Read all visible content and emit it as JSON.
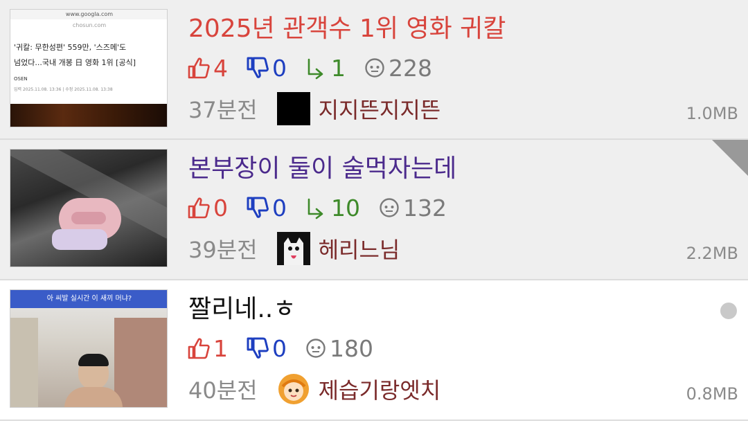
{
  "colors": {
    "title_red": "#d8443c",
    "title_purple": "#4b2a8c",
    "title_black": "#111111",
    "like": "#d8443c",
    "dislike": "#1e3fc0",
    "share": "#3e8a2a",
    "view": "#7a7a7a",
    "author": "#7a2a2a"
  },
  "posts": [
    {
      "title": "2025년 관객수 1위 영화 귀칼",
      "likes": "4",
      "dislikes": "0",
      "shares": "1",
      "views": "228",
      "time": "37분전",
      "author": "지지뜬지지뜬",
      "size": "1.0MB",
      "thumb": {
        "browser_url": "www.googla.com",
        "site": "chosun.com",
        "headline_1": "'귀칼: 무한성편' 559만, '스즈메'도",
        "headline_2": "넘었다...국내 개봉 日 영화 1위 [공식]",
        "source": "OSEN",
        "date_line": "입력 2025.11.08. 13:36 | 수정 2025.11.08. 13:38"
      }
    },
    {
      "title": "본부장이 둘이 술먹자는데",
      "likes": "0",
      "dislikes": "0",
      "shares": "10",
      "views": "132",
      "time": "39분전",
      "author": "헤리느님",
      "size": "2.2MB"
    },
    {
      "title": "짤리네..ㅎ",
      "likes": "1",
      "dislikes": "0",
      "views": "180",
      "time": "40분전",
      "author": "제습기랑엣치",
      "size": "0.8MB",
      "thumb": {
        "banner": "아 씨발 실시간 이 새끼 머냐?"
      }
    }
  ]
}
